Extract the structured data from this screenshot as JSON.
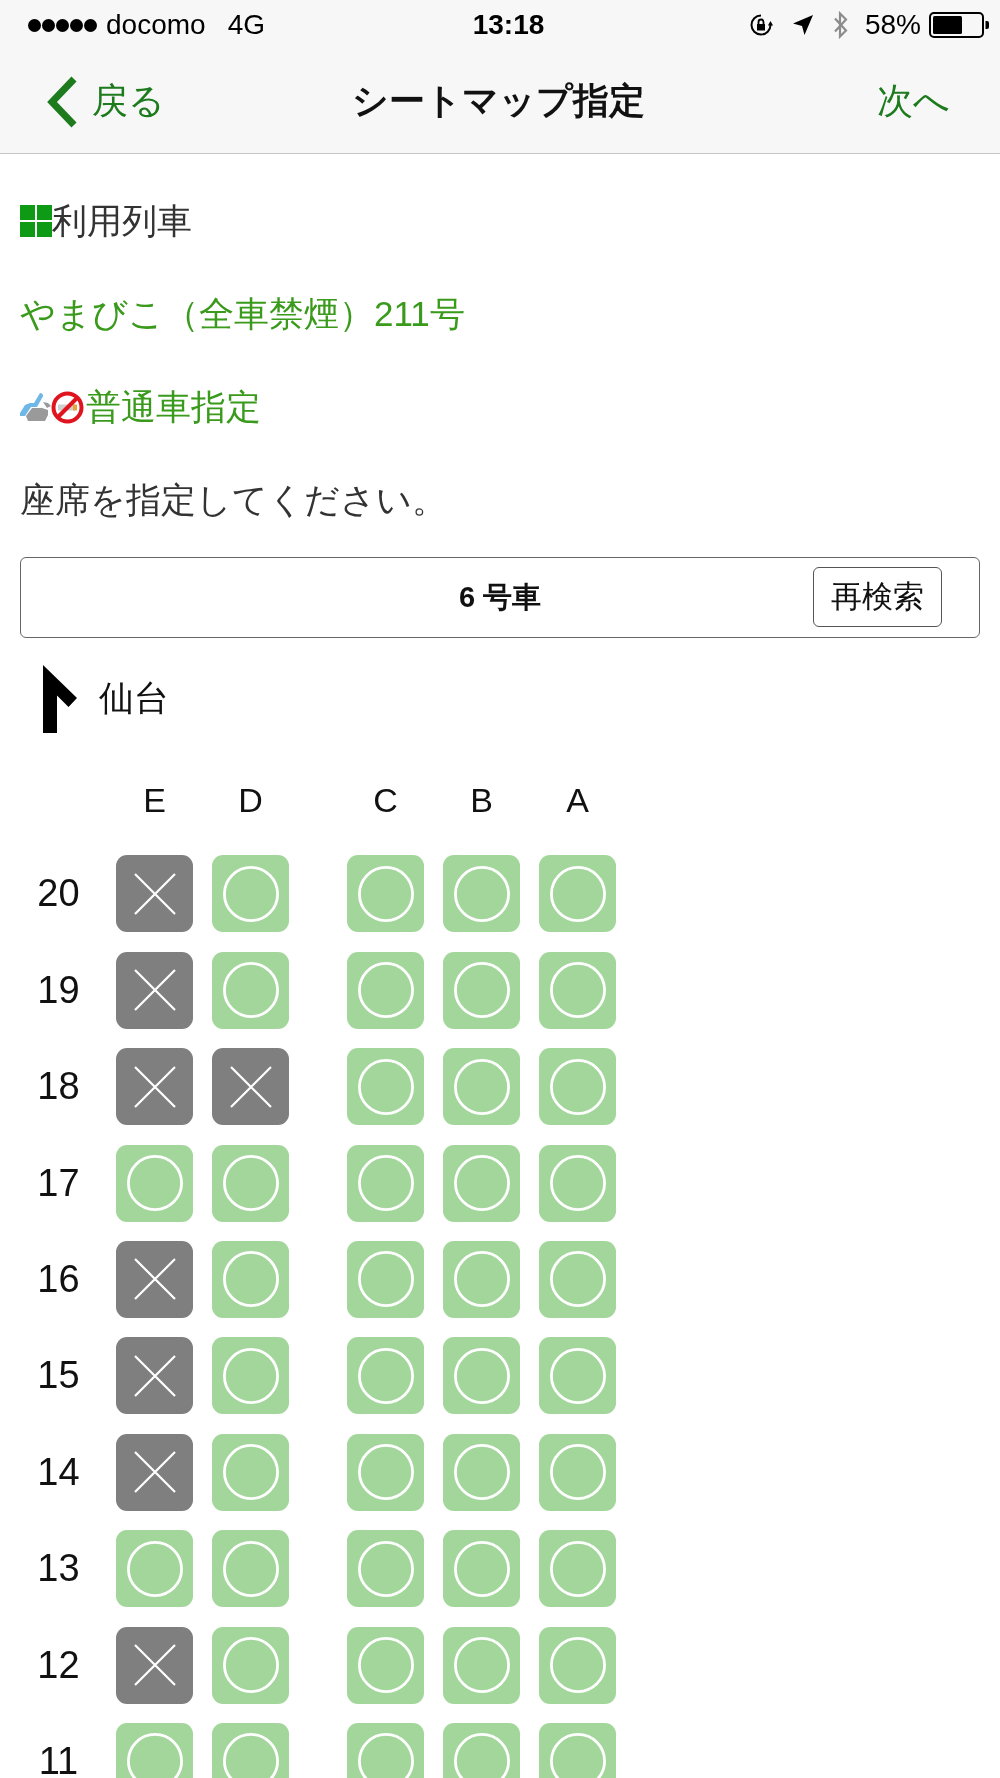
{
  "status_bar": {
    "carrier": "docomo",
    "network": "4G",
    "time": "13:18",
    "battery": "58%"
  },
  "nav": {
    "back": "戻る",
    "title": "シートマップ指定",
    "next": "次へ"
  },
  "train": {
    "heading": "利用列車",
    "name": "やまびこ（全車禁煙）211号",
    "seat_class": "普通車指定"
  },
  "instruction": "座席を指定してください。",
  "car": {
    "label": "6 号車",
    "button": "再検索"
  },
  "direction": {
    "label": "仙台"
  },
  "seat_map": {
    "columns": [
      "E",
      "D",
      "C",
      "B",
      "A"
    ],
    "rows": [
      {
        "number": "20",
        "seats": [
          {
            "available": false
          },
          {
            "available": true
          },
          {
            "available": true
          },
          {
            "available": true
          },
          {
            "available": true
          }
        ]
      },
      {
        "number": "19",
        "seats": [
          {
            "available": false
          },
          {
            "available": true
          },
          {
            "available": true
          },
          {
            "available": true
          },
          {
            "available": true
          }
        ]
      },
      {
        "number": "18",
        "seats": [
          {
            "available": false
          },
          {
            "available": false
          },
          {
            "available": true
          },
          {
            "available": true
          },
          {
            "available": true
          }
        ]
      },
      {
        "number": "17",
        "seats": [
          {
            "available": true
          },
          {
            "available": true
          },
          {
            "available": true
          },
          {
            "available": true
          },
          {
            "available": true
          }
        ]
      },
      {
        "number": "16",
        "seats": [
          {
            "available": false
          },
          {
            "available": true
          },
          {
            "available": true
          },
          {
            "available": true
          },
          {
            "available": true
          }
        ]
      },
      {
        "number": "15",
        "seats": [
          {
            "available": false
          },
          {
            "available": true
          },
          {
            "available": true
          },
          {
            "available": true
          },
          {
            "available": true
          }
        ]
      },
      {
        "number": "14",
        "seats": [
          {
            "available": false
          },
          {
            "available": true
          },
          {
            "available": true
          },
          {
            "available": true
          },
          {
            "available": true
          }
        ]
      },
      {
        "number": "13",
        "seats": [
          {
            "available": true
          },
          {
            "available": true
          },
          {
            "available": true
          },
          {
            "available": true
          },
          {
            "available": true
          }
        ]
      },
      {
        "number": "12",
        "seats": [
          {
            "available": false
          },
          {
            "available": true
          },
          {
            "available": true
          },
          {
            "available": true
          },
          {
            "available": true
          }
        ]
      },
      {
        "number": "11",
        "seats": [
          {
            "available": true
          },
          {
            "available": true
          },
          {
            "available": true
          },
          {
            "available": true
          },
          {
            "available": true
          }
        ]
      }
    ]
  }
}
